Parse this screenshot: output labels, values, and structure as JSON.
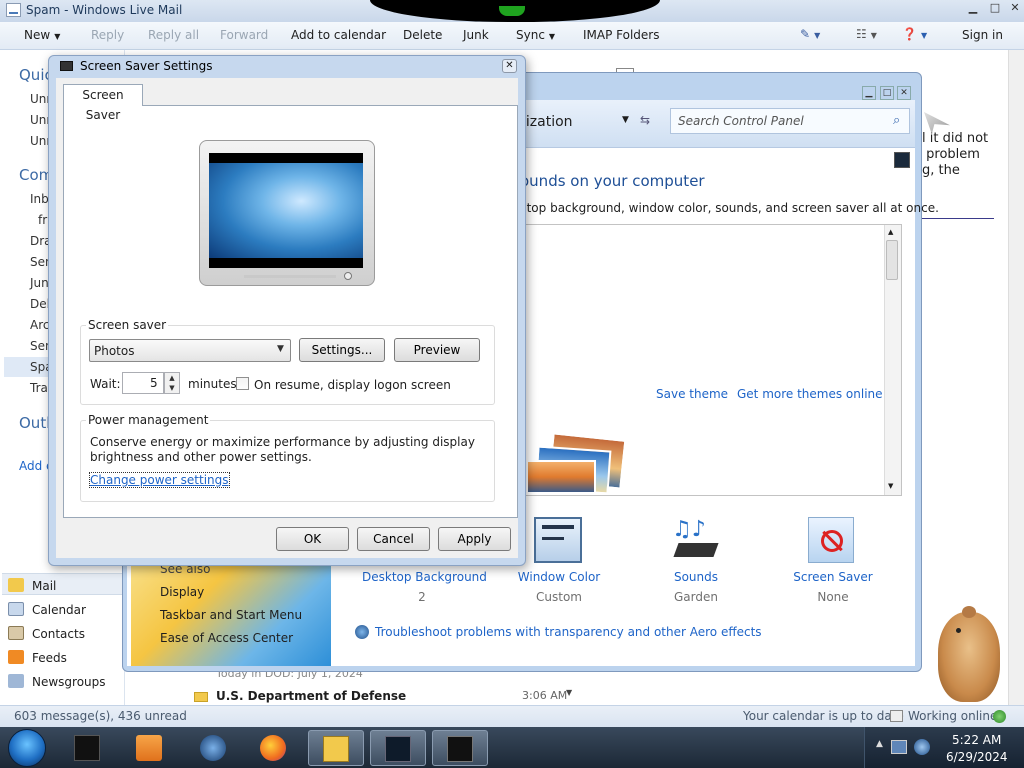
{
  "wlm": {
    "title": "Spam - Windows Live Mail",
    "toolbar": {
      "new": "New",
      "reply": "Reply",
      "reply_all": "Reply all",
      "forward": "Forward",
      "add_to_calendar": "Add to calendar",
      "delete": "Delete",
      "junk": "Junk",
      "sync": "Sync",
      "imap_folders": "IMAP Folders",
      "sign_in": "Sign in"
    },
    "folders": {
      "quick_header": "Quic",
      "quick_items": [
        "Unr",
        "Unr",
        "Unr"
      ],
      "com_header": "Com",
      "com_items": [
        "Inb",
        "fr",
        "Dra",
        "Sen",
        "Jun",
        "Del",
        "Arc",
        "Sen",
        "Spa",
        "Tra"
      ],
      "outbox": "Outb",
      "add": "Add e"
    },
    "nav": {
      "mail": "Mail",
      "calendar": "Calendar",
      "contacts": "Contacts",
      "feeds": "Feeds",
      "newsgroups": "Newsgroups"
    },
    "list": {
      "date_group": "Today in DOD: July 1, 2024",
      "sender": "U.S. Department of Defense",
      "time": "3:06 AM"
    },
    "reading_fragment": [
      "l it did not",
      " problem",
      "g, the"
    ],
    "status": {
      "messages": "603 message(s), 436 unread",
      "calendar": "Your calendar is up to date",
      "online": "Working online"
    }
  },
  "control_panel": {
    "crumb": "lization",
    "search_placeholder": "Search Control Panel",
    "heading": "ounds on your computer",
    "subheading": "ctop background, window color, sounds, and screen saver all at once.",
    "save_theme": "Save theme",
    "get_more_themes": "Get more themes online",
    "see_also": {
      "title": "See also",
      "items": [
        "Display",
        "Taskbar and Start Menu",
        "Ease of Access Center"
      ]
    },
    "items": [
      {
        "label": "Desktop Background",
        "sub": "2"
      },
      {
        "label": "Window Color",
        "sub": "Custom"
      },
      {
        "label": "Sounds",
        "sub": "Garden"
      },
      {
        "label": "Screen Saver",
        "sub": "None"
      }
    ],
    "troubleshoot": "Troubleshoot problems with transparency and other Aero effects"
  },
  "dialog": {
    "title": "Screen Saver Settings",
    "tab": "Screen Saver",
    "group_screensaver": "Screen saver",
    "select_value": "Photos",
    "settings_btn": "Settings...",
    "preview_btn": "Preview",
    "wait_label": "Wait:",
    "wait_value": "5",
    "minutes": "minutes",
    "resume_label": "On resume, display logon screen",
    "group_power": "Power management",
    "power_text_1": "Conserve energy or maximize performance by adjusting display",
    "power_text_2": "brightness and other power settings.",
    "power_link": "Change power settings",
    "ok": "OK",
    "cancel": "Cancel",
    "apply": "Apply"
  },
  "taskbar": {
    "time": "5:22 AM",
    "date": "6/29/2024"
  }
}
